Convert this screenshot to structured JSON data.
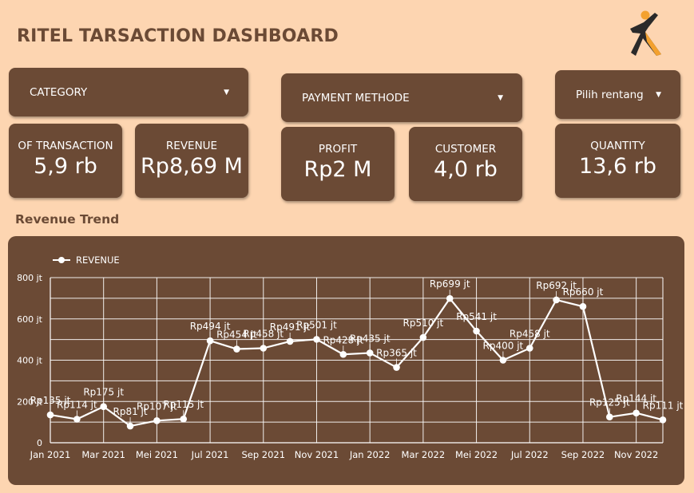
{
  "header": {
    "title": "RITEL TARSACTION DASHBOARD"
  },
  "filters": {
    "category": "CATEGORY",
    "payment_method": "PAYMENT METHODE",
    "date_range": "Pilih rentang"
  },
  "kpis": {
    "transactions": {
      "label": "OF TRANSACTION",
      "value": "5,9 rb"
    },
    "revenue": {
      "label": "REVENUE",
      "value": "Rp8,69 M"
    },
    "profit": {
      "label": "PROFIT",
      "value": "Rp2 M"
    },
    "customer": {
      "label": "CUSTOMER",
      "value": "4,0 rb"
    },
    "quantity": {
      "label": "QUANTITY",
      "value": "13,6 rb"
    }
  },
  "revenue_trend": {
    "title": "Revenue Trend"
  },
  "colors": {
    "background": "#fdd5b1",
    "card": "#6b4a35",
    "text_on_card": "#ffffff",
    "logo_orange": "#f3a12f",
    "logo_dark": "#2a2a2a"
  },
  "chart_data": {
    "type": "line",
    "ylim": [
      0,
      800
    ],
    "y_ticks": [
      "0",
      "200 jt",
      "400 jt",
      "600 jt",
      "800 jt"
    ],
    "y_tick_values": [
      0,
      200,
      400,
      600,
      800
    ],
    "x_tick_labels": [
      "Jan 2021",
      "Mar 2021",
      "Mei 2021",
      "Jul 2021",
      "Sep 2021",
      "Nov 2021",
      "Jan 2022",
      "Mar 2022",
      "Mei 2022",
      "Jul 2022",
      "Sep 2022",
      "Nov 2022"
    ],
    "x": [
      "2021-01",
      "2021-02",
      "2021-03",
      "2021-04",
      "2021-05",
      "2021-06",
      "2021-07",
      "2021-08",
      "2021-09",
      "2021-10",
      "2021-11",
      "2021-12",
      "2022-01",
      "2022-02",
      "2022-03",
      "2022-04",
      "2022-05",
      "2022-06",
      "2022-07",
      "2022-08",
      "2022-09",
      "2022-10",
      "2022-11",
      "2022-12"
    ],
    "legend_position": "top-left",
    "grid": true,
    "series": [
      {
        "name": "REVENUE",
        "values": [
          135,
          114,
          175,
          81,
          107,
          115,
          494,
          454,
          458,
          491,
          501,
          428,
          435,
          365,
          510,
          699,
          541,
          400,
          458,
          692,
          660,
          125,
          144,
          111
        ],
        "data_labels": [
          "Rp135 jt",
          "Rp114 jt",
          "Rp175 jt",
          "Rp81 jt",
          "Rp107 jt",
          "Rp115 jt",
          "Rp494 jt",
          "Rp454 jt",
          "Rp458 jt",
          "Rp491 jt",
          "Rp501 jt",
          "Rp428 jt",
          "Rp435 jt",
          "Rp365 jt",
          "Rp510 jt",
          "Rp699 jt",
          "Rp541 jt",
          "Rp400 jt",
          "Rp458 jt",
          "Rp692 jt",
          "Rp660 jt",
          "Rp125 jt",
          "Rp144 jt",
          "Rp111 jt"
        ]
      }
    ]
  }
}
